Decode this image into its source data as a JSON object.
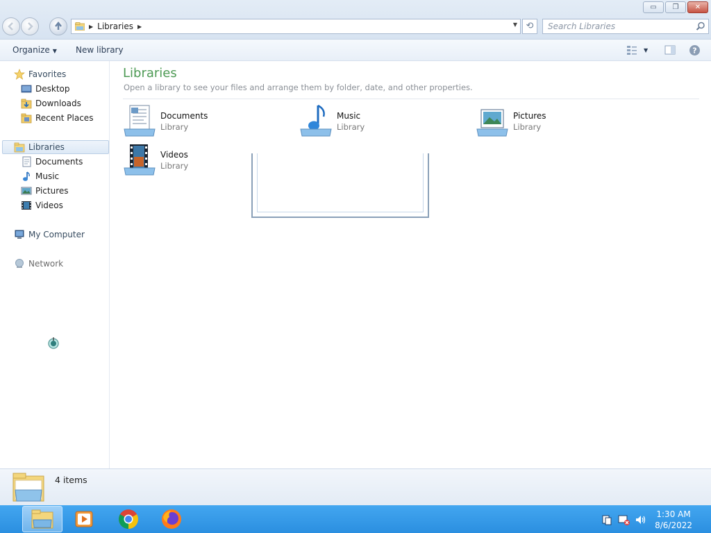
{
  "window": {
    "minimize_glyph": "▭",
    "maximize_glyph": "❐",
    "close_glyph": "✕"
  },
  "address": {
    "crumb": "Libraries",
    "search_placeholder": "Search Libraries"
  },
  "toolbar": {
    "organize_label": "Organize",
    "new_library_label": "New library"
  },
  "navigation": {
    "favorites_label": "Favorites",
    "favorites": [
      "Desktop",
      "Downloads",
      "Recent Places"
    ],
    "libraries_label": "Libraries",
    "libraries": [
      "Documents",
      "Music",
      "Pictures",
      "Videos"
    ],
    "computer_label": "My Computer",
    "network_label": "Network"
  },
  "content": {
    "title": "Libraries",
    "subtitle": "Open a library to see your files and arrange them by folder, date, and other properties.",
    "items": [
      {
        "name": "Documents",
        "type": "Library",
        "icon": "documents-library-icon"
      },
      {
        "name": "Music",
        "type": "Library",
        "icon": "music-library-icon"
      },
      {
        "name": "Pictures",
        "type": "Library",
        "icon": "pictures-library-icon"
      },
      {
        "name": "Videos",
        "type": "Library",
        "icon": "videos-library-icon"
      }
    ]
  },
  "details": {
    "item_count": "4 items"
  },
  "taskbar": {
    "apps": [
      "file-explorer-icon",
      "media-player-icon",
      "chrome-icon",
      "firefox-icon"
    ],
    "time": "1:30 AM",
    "date": "8/6/2022"
  },
  "colors": {
    "title_green": "#4d9a54",
    "taskbar_blue": "#2b8fe0",
    "selection_blue": "#dde9f6"
  }
}
